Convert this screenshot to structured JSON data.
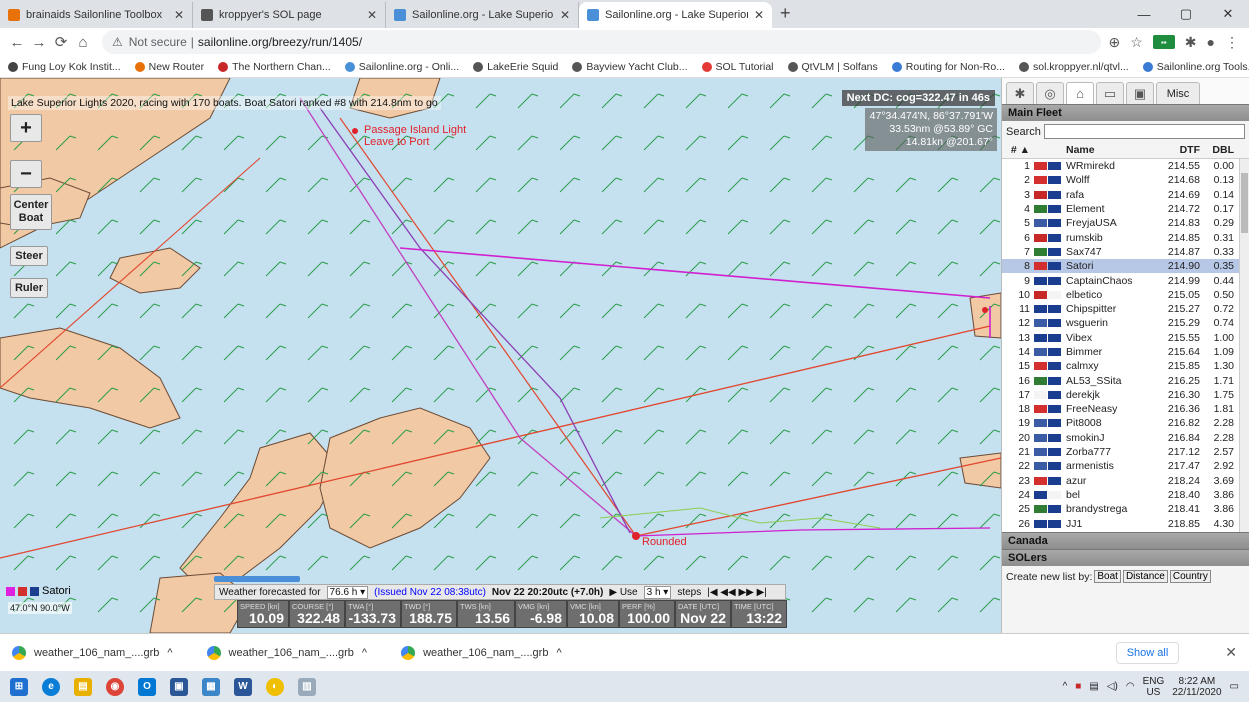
{
  "browser": {
    "tabs": [
      {
        "label": "brainaids Sailonline Toolbox",
        "color": "#e8710a",
        "active": false
      },
      {
        "label": "kroppyer's SOL page",
        "color": "#555555",
        "active": false
      },
      {
        "label": "Sailonline.org - Lake Superior Lig",
        "color": "#4a90d9",
        "active": false
      },
      {
        "label": "Sailonline.org - Lake Superior Lig",
        "color": "#4a90d9",
        "active": true
      }
    ],
    "new_tab": "+",
    "address": {
      "security": "Not secure",
      "url": "sailonline.org/breezy/run/1405/"
    },
    "bookmarks": [
      {
        "label": "Fung Loy Kok Instit...",
        "color": "#444444"
      },
      {
        "label": "New Router",
        "color": "#e8710a"
      },
      {
        "label": "The Northern Chan...",
        "color": "#c62828"
      },
      {
        "label": "Sailonline.org - Onli...",
        "color": "#4a90d9"
      },
      {
        "label": "LakeErie Squid",
        "color": "#555555"
      },
      {
        "label": "Bayview Yacht Club...",
        "color": "#555555"
      },
      {
        "label": "SOL Tutorial",
        "color": "#e53935"
      },
      {
        "label": "QtVLM | Solfans",
        "color": "#555555"
      },
      {
        "label": "Routing for Non-Ro...",
        "color": "#3a7bd5"
      },
      {
        "label": "sol.kroppyer.nl/qtvl...",
        "color": "#555555"
      },
      {
        "label": "Sailonline.org Tools...",
        "color": "#3a7bd5"
      }
    ]
  },
  "map": {
    "status": "Lake Superior Lights 2020, racing with 170 boats. Boat Satori ranked #8 with 214.8nm to go",
    "next_dc": "Next DC: cog=322.47 in 46s",
    "position": {
      "coords": "47°34.474'N, 86°37.791'W",
      "distance": "33.53nm @53.89° GC",
      "speed": "14.81kn @201.67°"
    },
    "buttons": {
      "zoom_in": "+",
      "zoom_out": "−",
      "center": "Center Boat",
      "steer": "Steer",
      "ruler": "Ruler"
    },
    "mark_label_1": "Passage Island Light",
    "mark_label_2": "Leave to Port",
    "mark_label_3": "Rounded",
    "boat_name": "Satori",
    "pos_box": "47.0°N 90.0°W"
  },
  "weather": {
    "forecast_label": "Weather forecasted for",
    "forecast_value": "76.6 h",
    "issued": "(Issued Nov 22 08:38utc)",
    "valid": "Nov 22 20:20utc (+7.0h)",
    "use_label": "▶ Use",
    "use_value": "3 h",
    "steps_label": "steps",
    "steps_controls": "|◀ ◀◀ ▶▶ ▶|"
  },
  "instruments": [
    {
      "label": "SPEED [kn]",
      "value": "10.09"
    },
    {
      "label": "COURSE [°]",
      "value": "322.48"
    },
    {
      "label": "TWA [°]",
      "value": "-133.73"
    },
    {
      "label": "TWD [°]",
      "value": "188.75"
    },
    {
      "label": "TWS [kn]",
      "value": "13.56"
    },
    {
      "label": "VMG [kn]",
      "value": "-6.98"
    },
    {
      "label": "VMC [kn]",
      "value": "10.08"
    },
    {
      "label": "PERF [%]",
      "value": "100.00"
    },
    {
      "label": "DATE [UTC]",
      "value": "Nov 22"
    },
    {
      "label": "TIME [UTC]",
      "value": "13:22"
    }
  ],
  "panel": {
    "tabs": [
      "✱",
      "◎",
      "⌂",
      "▭",
      "▣",
      "Misc"
    ],
    "fleet_title": "Main Fleet",
    "search_label": "Search",
    "search_value": "",
    "columns": {
      "rank": "# ▲",
      "name": "Name",
      "dtf": "DTF",
      "dbl": "DBL"
    },
    "boats": [
      {
        "rank": "1",
        "name": "WRmirekd",
        "dtf": "214.55",
        "dbl": "0.00",
        "f1": "#d32f2f",
        "f2": "#1a3d8f"
      },
      {
        "rank": "2",
        "name": "Wolff",
        "dtf": "214.68",
        "dbl": "0.13",
        "f1": "#d32f2f",
        "f2": "#1a3d8f"
      },
      {
        "rank": "3",
        "name": "rafa",
        "dtf": "214.69",
        "dbl": "0.14",
        "f1": "#c62828",
        "f2": "#1a3d8f"
      },
      {
        "rank": "4",
        "name": "Element",
        "dtf": "214.72",
        "dbl": "0.17",
        "f1": "#2e7d32",
        "f2": "#1a3d8f"
      },
      {
        "rank": "5",
        "name": "FreyjaUSA",
        "dtf": "214.83",
        "dbl": "0.29",
        "f1": "#3b5ba5",
        "f2": "#1a3d8f"
      },
      {
        "rank": "6",
        "name": "rumskib",
        "dtf": "214.85",
        "dbl": "0.31",
        "f1": "#c62828",
        "f2": "#1a3d8f"
      },
      {
        "rank": "7",
        "name": "Sax747",
        "dtf": "214.87",
        "dbl": "0.33",
        "f1": "#2e7d32",
        "f2": "#1a3d8f"
      },
      {
        "rank": "8",
        "name": "Satori",
        "dtf": "214.90",
        "dbl": "0.35",
        "f1": "#d32f2f",
        "f2": "#1a3d8f"
      },
      {
        "rank": "9",
        "name": "CaptainChaos",
        "dtf": "214.99",
        "dbl": "0.44",
        "f1": "#1a3d8f",
        "f2": "#1a3d8f"
      },
      {
        "rank": "10",
        "name": "elbetico",
        "dtf": "215.05",
        "dbl": "0.50",
        "f1": "#c62828",
        "f2": "#f4f4f4"
      },
      {
        "rank": "11",
        "name": "Chipspitter",
        "dtf": "215.27",
        "dbl": "0.72",
        "f1": "#1a3d8f",
        "f2": "#1a3d8f"
      },
      {
        "rank": "12",
        "name": "wsguerin",
        "dtf": "215.29",
        "dbl": "0.74",
        "f1": "#3b5ba5",
        "f2": "#1a3d8f"
      },
      {
        "rank": "13",
        "name": "Vibex",
        "dtf": "215.55",
        "dbl": "1.00",
        "f1": "#1a3d8f",
        "f2": "#1a3d8f"
      },
      {
        "rank": "14",
        "name": "Bimmer",
        "dtf": "215.64",
        "dbl": "1.09",
        "f1": "#3b5ba5",
        "f2": "#1a3d8f"
      },
      {
        "rank": "15",
        "name": "calmxy",
        "dtf": "215.85",
        "dbl": "1.30",
        "f1": "#d32f2f",
        "f2": "#1a3d8f"
      },
      {
        "rank": "16",
        "name": "AL53_SSita",
        "dtf": "216.25",
        "dbl": "1.71",
        "f1": "#2e7d32",
        "f2": "#1a3d8f"
      },
      {
        "rank": "17",
        "name": "derekjk",
        "dtf": "216.30",
        "dbl": "1.75",
        "f1": "#f4f4f4",
        "f2": "#1a3d8f"
      },
      {
        "rank": "18",
        "name": "FreeNeasy",
        "dtf": "216.36",
        "dbl": "1.81",
        "f1": "#d32f2f",
        "f2": "#1a3d8f"
      },
      {
        "rank": "19",
        "name": "Pit8008",
        "dtf": "216.82",
        "dbl": "2.28",
        "f1": "#3b5ba5",
        "f2": "#1a3d8f"
      },
      {
        "rank": "20",
        "name": "smokinJ",
        "dtf": "216.84",
        "dbl": "2.28",
        "f1": "#3b5ba5",
        "f2": "#1a3d8f"
      },
      {
        "rank": "21",
        "name": "Zorba777",
        "dtf": "217.12",
        "dbl": "2.57",
        "f1": "#3b5ba5",
        "f2": "#1a3d8f"
      },
      {
        "rank": "22",
        "name": "armenistis",
        "dtf": "217.47",
        "dbl": "2.92",
        "f1": "#3b5ba5",
        "f2": "#1a3d8f"
      },
      {
        "rank": "23",
        "name": "azur",
        "dtf": "218.24",
        "dbl": "3.69",
        "f1": "#d32f2f",
        "f2": "#1a3d8f"
      },
      {
        "rank": "24",
        "name": "bel",
        "dtf": "218.40",
        "dbl": "3.86",
        "f1": "#1a3d8f",
        "f2": "#f4f4f4"
      },
      {
        "rank": "25",
        "name": "brandystrega",
        "dtf": "218.41",
        "dbl": "3.86",
        "f1": "#2e7d32",
        "f2": "#1a3d8f"
      },
      {
        "rank": "26",
        "name": "JJ1",
        "dtf": "218.85",
        "dbl": "4.30",
        "f1": "#1a3d8f",
        "f2": "#1a3d8f"
      }
    ],
    "selected_rank": "8",
    "canada": "Canada",
    "solers": "SOLers",
    "create_label": "Create new list by:",
    "create_buttons": [
      "Boat",
      "Distance",
      "Country"
    ]
  },
  "downloads": {
    "items": [
      "weather_106_nam_....grb",
      "weather_106_nam_....grb",
      "weather_106_nam_....grb"
    ],
    "show_all": "Show all"
  },
  "taskbar": {
    "lang": "ENG",
    "region": "US",
    "time": "8:22 AM",
    "date": "22/11/2020"
  }
}
